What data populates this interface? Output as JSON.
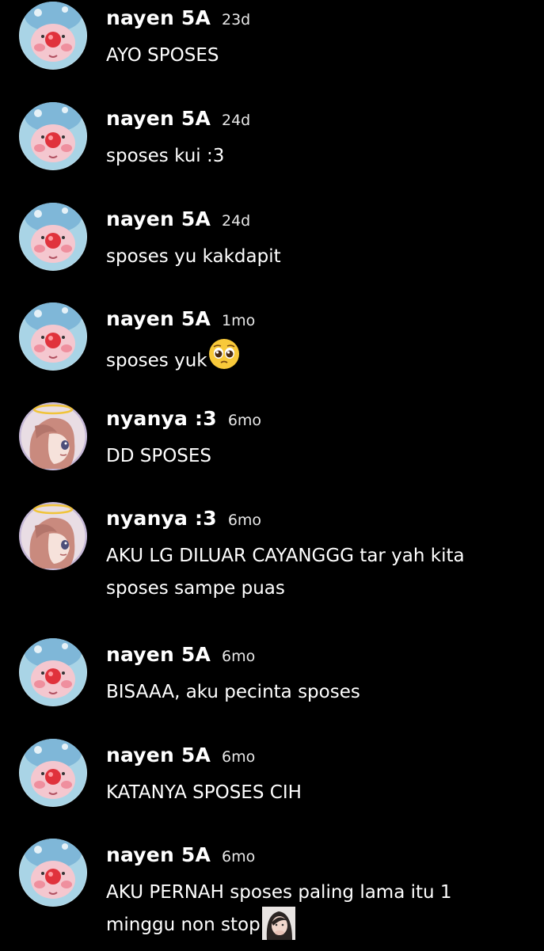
{
  "messages": [
    {
      "user": "nayen 5A",
      "time": "23d",
      "text": "AYO SPOSES",
      "avatar": "pink-seal-blue-hat-avatar"
    },
    {
      "user": "nayen 5A",
      "time": "24d",
      "text": "sposes kui :3",
      "avatar": "pink-seal-blue-hat-avatar"
    },
    {
      "user": "nayen 5A",
      "time": "24d",
      "text": "sposes yu kakdapit",
      "avatar": "pink-seal-blue-hat-avatar"
    },
    {
      "user": "nayen 5A",
      "time": "1mo",
      "text": "sposes yuk",
      "avatar": "pink-seal-blue-hat-avatar",
      "emoji": "pleading-face"
    },
    {
      "user": "nyanya :3",
      "time": "6mo",
      "text": "DD SPOSES",
      "avatar": "anime-girl-halo-avatar"
    },
    {
      "user": "nyanya :3",
      "time": "6mo",
      "text": "AKU LG DILUAR CAYANGGG tar yah kita sposes sampe puas",
      "avatar": "anime-girl-halo-avatar"
    },
    {
      "user": "nayen 5A",
      "time": "6mo",
      "text": "BISAAA, aku pecinta sposes",
      "avatar": "pink-seal-blue-hat-avatar"
    },
    {
      "user": "nayen 5A",
      "time": "6mo",
      "text": "KATANYA SPOSES CIH",
      "avatar": "pink-seal-blue-hat-avatar"
    },
    {
      "user": "nayen 5A",
      "time": "6mo",
      "text": "AKU PERNAH sposes paling lama itu 1 minggu non stop",
      "avatar": "pink-seal-blue-hat-avatar",
      "emoji": "girl-photo-sticker"
    }
  ],
  "colors": {
    "background": "#000000",
    "text": "#ffffff",
    "timestamp": "#e8e8e8"
  }
}
